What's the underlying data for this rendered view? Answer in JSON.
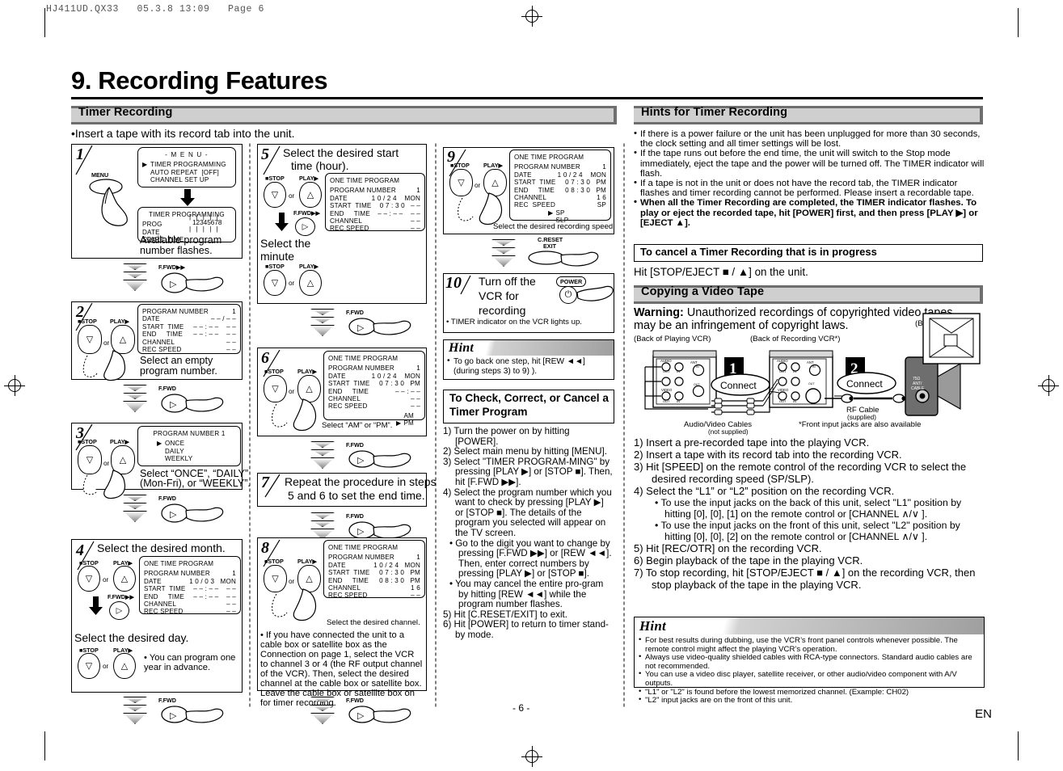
{
  "file_header": "HJ411UD.QX33   05.3.8 13:09   Page 6",
  "chapter_title": "9. Recording Features",
  "page_number": "- 6 -",
  "language_code": "EN",
  "left": {
    "section_header": "Timer Recording",
    "intro": "•Insert a tape with its record tab into the unit.",
    "step1": {
      "num": "1",
      "button_label": "MENU",
      "osd_menu_title": "- M E N U -",
      "osd_menu_items": [
        "TIMER PROGRAMMING",
        "AUTO REPEAT  [OFF]",
        "CHANNEL SET UP"
      ],
      "osd2_title": "TIMER PROGRAMMING",
      "osd2_rows": [
        "PROG",
        "DATE",
        "START  TIME"
      ],
      "flash_value": "12345678",
      "caption": "Available program number flashes."
    },
    "step2": {
      "num": "2",
      "key_left": "STOP",
      "key_right": "PLAY",
      "or": "or",
      "osd_rows": [
        {
          "label": "PROGRAM NUMBER",
          "value": "1"
        },
        {
          "label": "DATE",
          "value": "– – / – –"
        },
        {
          "label": "START  TIME",
          "value": "– – : – –    – –"
        },
        {
          "label": "END     TIME",
          "value": "– – : – –    – –"
        },
        {
          "label": "CHANNEL",
          "value": "– –"
        },
        {
          "label": "REC SPEED",
          "value": "– –"
        }
      ],
      "caption": "Select an empty program number.",
      "next_key": "F.FWD"
    },
    "step3": {
      "num": "3",
      "key_left": "STOP",
      "key_right": "PLAY",
      "or": "or",
      "osd_title": "PROGRAM  NUMBER   1",
      "osd_options": [
        "ONCE",
        "DAILY",
        "WEEKLY"
      ],
      "selected_option": "ONCE",
      "caption_line1": "Select “ONCE”, “DAILY”",
      "caption_line2": "(Mon-Fri), or “WEEKLY”.",
      "next_key": "F.FWD"
    },
    "step4": {
      "num": "4",
      "heading": "Select the desired month.",
      "key_left": "STOP",
      "key_right": "PLAY",
      "or": "or",
      "mid_key": "F.FWD",
      "osd_title": "ONE TIME PROGRAM",
      "osd_rows": [
        {
          "label": "PROGRAM NUMBER",
          "value": "1"
        },
        {
          "label": "DATE",
          "value": "1 0 / 0 3   MON"
        },
        {
          "label": "START  TIME",
          "value": "– – : – –    – –"
        },
        {
          "label": "END     TIME",
          "value": "– – : – –    – –"
        },
        {
          "label": "CHANNEL",
          "value": "– –"
        },
        {
          "label": "REC SPEED",
          "value": "– –"
        }
      ],
      "heading2": "Select the desired day.",
      "note": "• You can program one year in advance.",
      "next_key": "F.FWD"
    }
  },
  "mid": {
    "step5": {
      "num": "5",
      "heading_line1": "Select the desired start",
      "heading_line2": "time (hour).",
      "key_left": "STOP",
      "key_right": "PLAY",
      "or": "or",
      "mid_key": "F.FWD",
      "osd_title": "ONE TIME PROGRAM",
      "osd_rows": [
        {
          "label": "PROGRAM NUMBER",
          "value": "1"
        },
        {
          "label": "DATE",
          "value": "1 0 / 2 4    MON"
        },
        {
          "label": "START  TIME",
          "value": "0 7 : 3 0   – –"
        },
        {
          "label": "END     TIME",
          "value": "– – : – –    – –"
        },
        {
          "label": "CHANNEL",
          "value": "– –"
        },
        {
          "label": "REC SPEED",
          "value": "– –"
        }
      ],
      "sub_heading_line1": "Select the",
      "sub_heading_line2": "minute",
      "next_key": "F.FWD"
    },
    "step6": {
      "num": "6",
      "key_left": "STOP",
      "key_right": "PLAY",
      "or": "or",
      "osd_title": "ONE TIME PROGRAM",
      "osd_rows": [
        {
          "label": "PROGRAM NUMBER",
          "value": "1"
        },
        {
          "label": "DATE",
          "value": "1 0 / 2 4    MON"
        },
        {
          "label": "START  TIME",
          "value": "0 7 : 3 0   PM"
        },
        {
          "label": "END     TIME",
          "value": "– – : – –"
        },
        {
          "label": "CHANNEL",
          "value": "– –"
        },
        {
          "label": "REC SPEED",
          "value": "– –"
        }
      ],
      "ampm": [
        "AM",
        "PM"
      ],
      "ampm_selected": "PM",
      "caption": "Select “AM” or “PM”.",
      "next_key": "F.FWD"
    },
    "step7": {
      "num": "7",
      "line1": "Repeat the procedure in steps",
      "line2": "5 and 6 to set the end time.",
      "next_key": "F.FWD"
    },
    "step8": {
      "num": "8",
      "key_left": "STOP",
      "key_right": "PLAY",
      "or": "or",
      "osd_title": "ONE TIME PROGRAM",
      "osd_rows": [
        {
          "label": "PROGRAM NUMBER",
          "value": "1"
        },
        {
          "label": "DATE",
          "value": "1 0 / 2 4   MON"
        },
        {
          "label": "START  TIME",
          "value": "0 7 : 3 0   PM"
        },
        {
          "label": "END     TIME",
          "value": "0 8 : 3 0   PM"
        },
        {
          "label": "CHANNEL",
          "value": "1 6"
        },
        {
          "label": "REC SPEED",
          "value": "– –"
        }
      ],
      "caption": "Select the desired channel.",
      "note": "• If you have connected the unit to a cable box or satellite box as the Connection on page 1, select the VCR to channel 3 or 4 (the RF output channel of the VCR). Then, select the desired channel at the cable box or satellite box. Leave the cable box or satellite box on for timer recording.",
      "next_key": "F.FWD"
    }
  },
  "right_col": {
    "step9": {
      "num": "9",
      "key_left": "STOP",
      "key_right": "PLAY",
      "or": "or",
      "osd_title": "ONE TIME PROGRAM",
      "osd_rows": [
        {
          "label": "PROGRAM NUMBER",
          "value": "1"
        },
        {
          "label": "DATE",
          "value": "1 0 / 2 4    MON"
        },
        {
          "label": "START  TIME",
          "value": "0 7 : 3 0   PM"
        },
        {
          "label": "END     TIME",
          "value": "0 8 : 3 0   PM"
        },
        {
          "label": "CHANNEL",
          "value": "1 6"
        },
        {
          "label": "REC  SPEED",
          "value": "SP"
        }
      ],
      "speed_options": [
        "SP",
        "SLP"
      ],
      "speed_selected": "SP",
      "caption": "Select the desired recording speed.",
      "next_key_line1": "C.RESET",
      "next_key_line2": "EXIT"
    },
    "step10": {
      "num": "10",
      "line1": "Turn off the",
      "line2": "VCR for",
      "line3": "recording",
      "power_label": "POWER",
      "note": "• TIMER indicator on the VCR lights up."
    },
    "hint": {
      "title": "Hint",
      "items": [
        "To go back one step, hit [REW ◄◄] (during steps 3) to 9) )."
      ]
    },
    "check_box_title_line1": "To Check, Correct, or Cancel a",
    "check_box_title_line2": "Timer Program",
    "check_steps": [
      "1) Turn the power on by hitting [POWER].",
      "2) Select main menu by hitting [MENU].",
      "3) Select \"TIMER PROGRAM-MING\" by pressing [PLAY ▶] or [STOP ■]. Then, hit [F.FWD ▶▶].",
      "4) Select the program number which you want to check by pressing [PLAY ▶] or [STOP ■]. The details of the program you selected will appear on the TV screen.",
      "• Go to the digit you want to change by pressing [F.FWD ▶▶] or [REW ◄◄]. Then, enter correct numbers by pressing [PLAY ▶] or [STOP ■].",
      "• You may cancel the entire pro-gram by hitting [REW ◄◄] while the program number flashes.",
      "5) Hit [C.RESET/EXIT] to exit.",
      "6) Hit [POWER] to return to timer stand-by mode."
    ]
  },
  "right": {
    "hints_header": "Hints for Timer Recording",
    "hints": [
      {
        "bold": false,
        "text": "If there is a power failure or the unit has been unplugged for more than 30 seconds, the clock setting and all timer settings will be lost."
      },
      {
        "bold": false,
        "text": "If the tape runs out before the end time, the unit will switch to the Stop mode immediately, eject the tape and the power will be turned off. The TIMER indicator will flash."
      },
      {
        "bold": false,
        "text": "If a tape is not in the unit or does not have the record tab, the TIMER indicator flashes and timer recording cannot be performed. Please insert a recordable tape."
      },
      {
        "bold": true,
        "text": "When all the Timer Recording are completed, the TIMER indicator flashes. To play or eject the recorded tape, hit [POWER] first, and then press [PLAY ▶] or [EJECT ▲]."
      }
    ],
    "cancel_box_title": "To cancel a Timer Recording that is in progress",
    "cancel_text": "Hit [STOP/EJECT ■ / ▲] on the unit.",
    "copy_header": "Copying a Video Tape",
    "warning_bold": "Warning:",
    "warning_text": " Unauthorized recordings of copyrighted video tapes may be an infringement of copyright laws.",
    "diagram": {
      "label_playing": "(Back of Playing VCR)",
      "label_recording": "(Back of Recording VCR*)",
      "label_tv": "(Back of TV)",
      "badge1": "1",
      "badge2": "2",
      "connect1": "Connect",
      "connect2": "Connect",
      "av_cables": "Audio/Video Cables",
      "av_cables_sub": "(not supplied)",
      "rf_cable": "RF Cable",
      "rf_cable_sub": "(supplied)",
      "front_jacks_note": "*Front input jacks are also available",
      "tv_jack_label": "75Ω\nANT/\nCABLE",
      "vcr_jack_labels": [
        "AUDIO",
        "L",
        "R",
        "OUT",
        "IN",
        "ANT",
        "IN",
        "OUT",
        "VIDEO",
        "OUT",
        "IN"
      ]
    },
    "copy_steps": [
      "1)  Insert a pre-recorded tape into the playing VCR.",
      "2)  Insert a tape with its record tab into the recording VCR.",
      "3)  Hit [SPEED] on the remote control of the recording VCR to select the desired recording speed (SP/SLP).",
      "4)  Select the “L1” or “L2” position on the recording VCR.",
      "• To use the input jacks on the back of this unit, select \"L1\" position by hitting [0], [0], [1] on the remote control or [CHANNEL  ∧/∨ ].",
      "• To use the input jacks on the front of this unit, select \"L2\" position by hitting [0], [0], [2] on the remote control or [CHANNEL  ∧/∨ ].",
      "5)  Hit [REC/OTR] on the recording VCR.",
      "6)  Begin playback of the tape in the playing VCR.",
      "7)  To stop recording, hit [STOP/EJECT ■ / ▲] on the recording VCR, then stop playback of the tape in the playing VCR."
    ],
    "hint2": {
      "title": "Hint",
      "items": [
        "For best results during dubbing, use the VCR’s front panel controls whenever possible. The remote control might affect the playing VCR’s operation.",
        "Always use video-quality shielded cables with RCA-type connectors. Standard audio cables are not recommended.",
        "You can use a video disc player, satellite receiver, or other audio/video component with A/V outputs.",
        "\"L1\" or \"L2\" is found before the lowest memorized channel. (Example: CH02)",
        "\"L2\" input jacks are on the front of this unit."
      ]
    }
  }
}
